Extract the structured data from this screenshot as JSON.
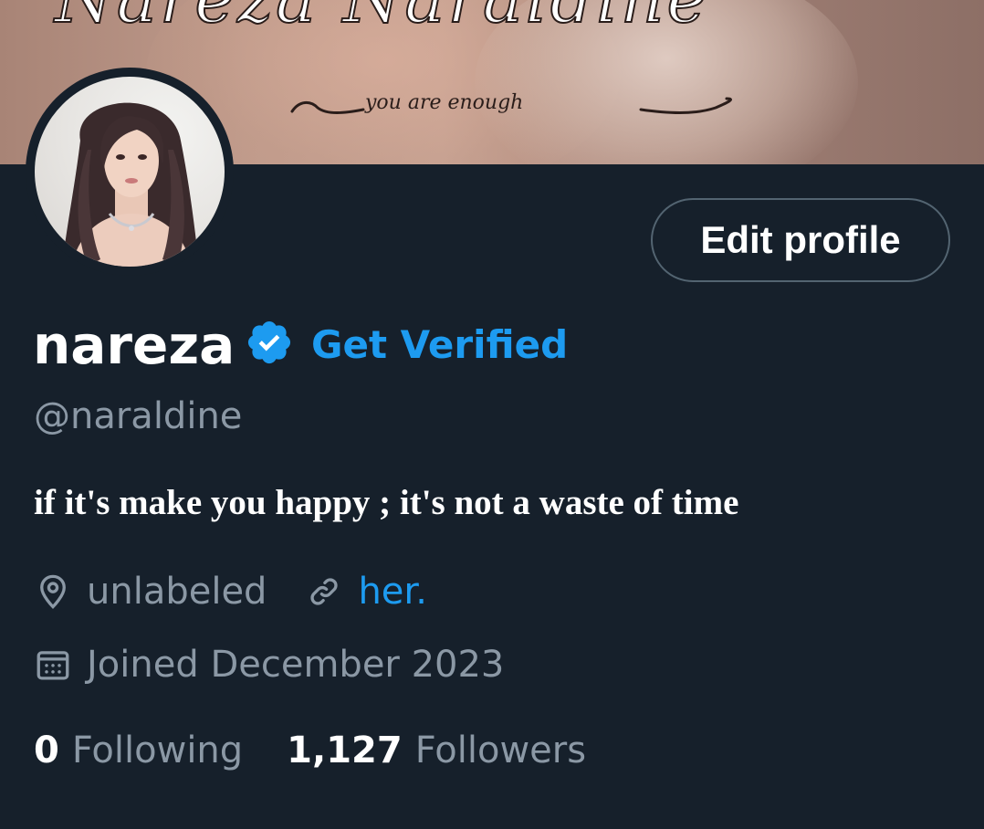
{
  "banner": {
    "title": "Nareza Naraldine",
    "tagline": "you are enough"
  },
  "profile": {
    "display_name": "nareza",
    "verified_badge_icon": "verified-badge-icon",
    "get_verified_label": "Get Verified",
    "handle": "@naraldine",
    "edit_profile_label": "Edit profile",
    "bio": "if it's make you happy ; it's not a waste of time"
  },
  "meta": {
    "location_icon": "location-pin-icon",
    "location": "unlabeled",
    "link_icon": "link-icon",
    "link_text": "her.",
    "joined_icon": "calendar-icon",
    "joined": "Joined December 2023"
  },
  "stats": {
    "following_count": "0",
    "following_label": "Following",
    "followers_count": "1,127",
    "followers_label": "Followers"
  },
  "colors": {
    "background": "#16202b",
    "accent": "#1d9bf0",
    "secondary_text": "#8b98a5",
    "primary_text": "#ffffff",
    "button_border": "#536471"
  }
}
